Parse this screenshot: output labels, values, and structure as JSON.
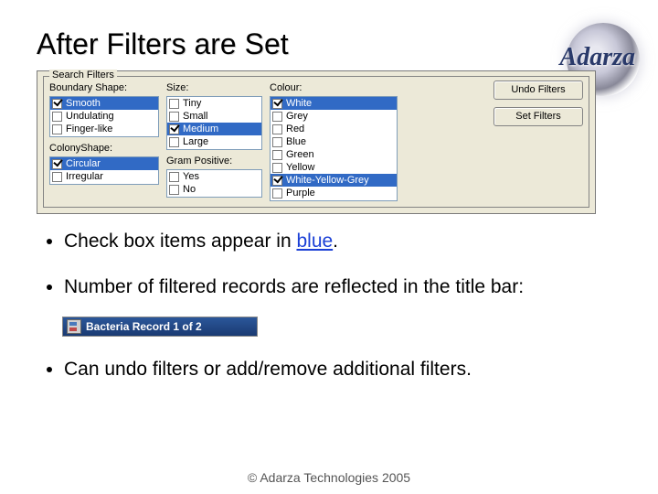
{
  "title": "After Filters are Set",
  "logo_text": "Adarza",
  "panel": {
    "legend": "Search Filters",
    "columns": {
      "boundary": {
        "label": "Boundary Shape:",
        "items": [
          {
            "label": "Smooth",
            "checked": true,
            "selected": true
          },
          {
            "label": "Undulating",
            "checked": false,
            "selected": false
          },
          {
            "label": "Finger-like",
            "checked": false,
            "selected": false
          }
        ]
      },
      "size": {
        "label": "Size:",
        "items": [
          {
            "label": "Tiny",
            "checked": false,
            "selected": false
          },
          {
            "label": "Small",
            "checked": false,
            "selected": false
          },
          {
            "label": "Medium",
            "checked": true,
            "selected": true
          },
          {
            "label": "Large",
            "checked": false,
            "selected": false
          }
        ]
      },
      "colour": {
        "label": "Colour:",
        "items": [
          {
            "label": "White",
            "checked": true,
            "selected": true
          },
          {
            "label": "Grey",
            "checked": false,
            "selected": false
          },
          {
            "label": "Red",
            "checked": false,
            "selected": false
          },
          {
            "label": "Blue",
            "checked": false,
            "selected": false
          },
          {
            "label": "Green",
            "checked": false,
            "selected": false
          },
          {
            "label": "Yellow",
            "checked": false,
            "selected": false
          },
          {
            "label": "White-Yellow-Grey",
            "checked": true,
            "selected": true
          },
          {
            "label": "Purple",
            "checked": false,
            "selected": false
          }
        ]
      },
      "colony": {
        "label": "ColonyShape:",
        "items": [
          {
            "label": "Circular",
            "checked": true,
            "selected": true
          },
          {
            "label": "Irregular",
            "checked": false,
            "selected": false
          }
        ]
      },
      "gram": {
        "label": "Gram Positive:",
        "items": [
          {
            "label": "Yes",
            "checked": false,
            "selected": false
          },
          {
            "label": "No",
            "checked": false,
            "selected": false
          }
        ]
      }
    },
    "buttons": {
      "undo": "Undo Filters",
      "set": "Set Filters"
    }
  },
  "bullets": {
    "b1_pre": "Check box items appear in ",
    "b1_blue": "blue",
    "b1_post": ".",
    "b2": "Number of filtered records are reflected in the title bar:",
    "b3": "Can undo filters or add/remove additional  filters."
  },
  "titlebar_caption": "Bacteria Record 1 of 2",
  "footer": "© Adarza Technologies 2005"
}
